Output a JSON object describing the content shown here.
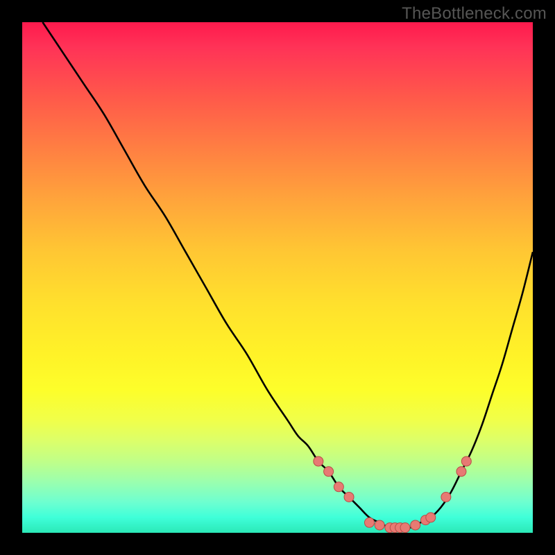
{
  "watermark": "TheBottleneck.com",
  "colors": {
    "marker_fill": "#e77a73",
    "marker_stroke": "#ba4c47",
    "curve_stroke": "#000000"
  },
  "chart_data": {
    "type": "line",
    "title": "",
    "xlabel": "",
    "ylabel": "",
    "xlim": [
      0,
      100
    ],
    "ylim": [
      0,
      100
    ],
    "x": [
      4,
      8,
      12,
      16,
      20,
      24,
      28,
      32,
      36,
      40,
      44,
      48,
      52,
      54,
      56,
      58,
      60,
      62,
      64,
      66,
      68,
      70,
      72,
      74,
      76,
      78,
      80,
      82,
      84,
      86,
      88,
      90,
      92,
      94,
      96,
      98,
      100
    ],
    "y": [
      100,
      94,
      88,
      82,
      75,
      68,
      62,
      55,
      48,
      41,
      35,
      28,
      22,
      19,
      17,
      14,
      12,
      9,
      7,
      5,
      3,
      2,
      1,
      1,
      1,
      2,
      3,
      5,
      8,
      12,
      16,
      21,
      27,
      33,
      40,
      47,
      55
    ],
    "markers": [
      {
        "x": 58,
        "y": 14
      },
      {
        "x": 60,
        "y": 12
      },
      {
        "x": 62,
        "y": 9
      },
      {
        "x": 64,
        "y": 7
      },
      {
        "x": 68,
        "y": 2
      },
      {
        "x": 70,
        "y": 1.5
      },
      {
        "x": 72,
        "y": 1
      },
      {
        "x": 73,
        "y": 1
      },
      {
        "x": 74,
        "y": 1
      },
      {
        "x": 75,
        "y": 1
      },
      {
        "x": 77,
        "y": 1.5
      },
      {
        "x": 79,
        "y": 2.5
      },
      {
        "x": 80,
        "y": 3
      },
      {
        "x": 83,
        "y": 7
      },
      {
        "x": 86,
        "y": 12
      },
      {
        "x": 87,
        "y": 14
      }
    ]
  }
}
